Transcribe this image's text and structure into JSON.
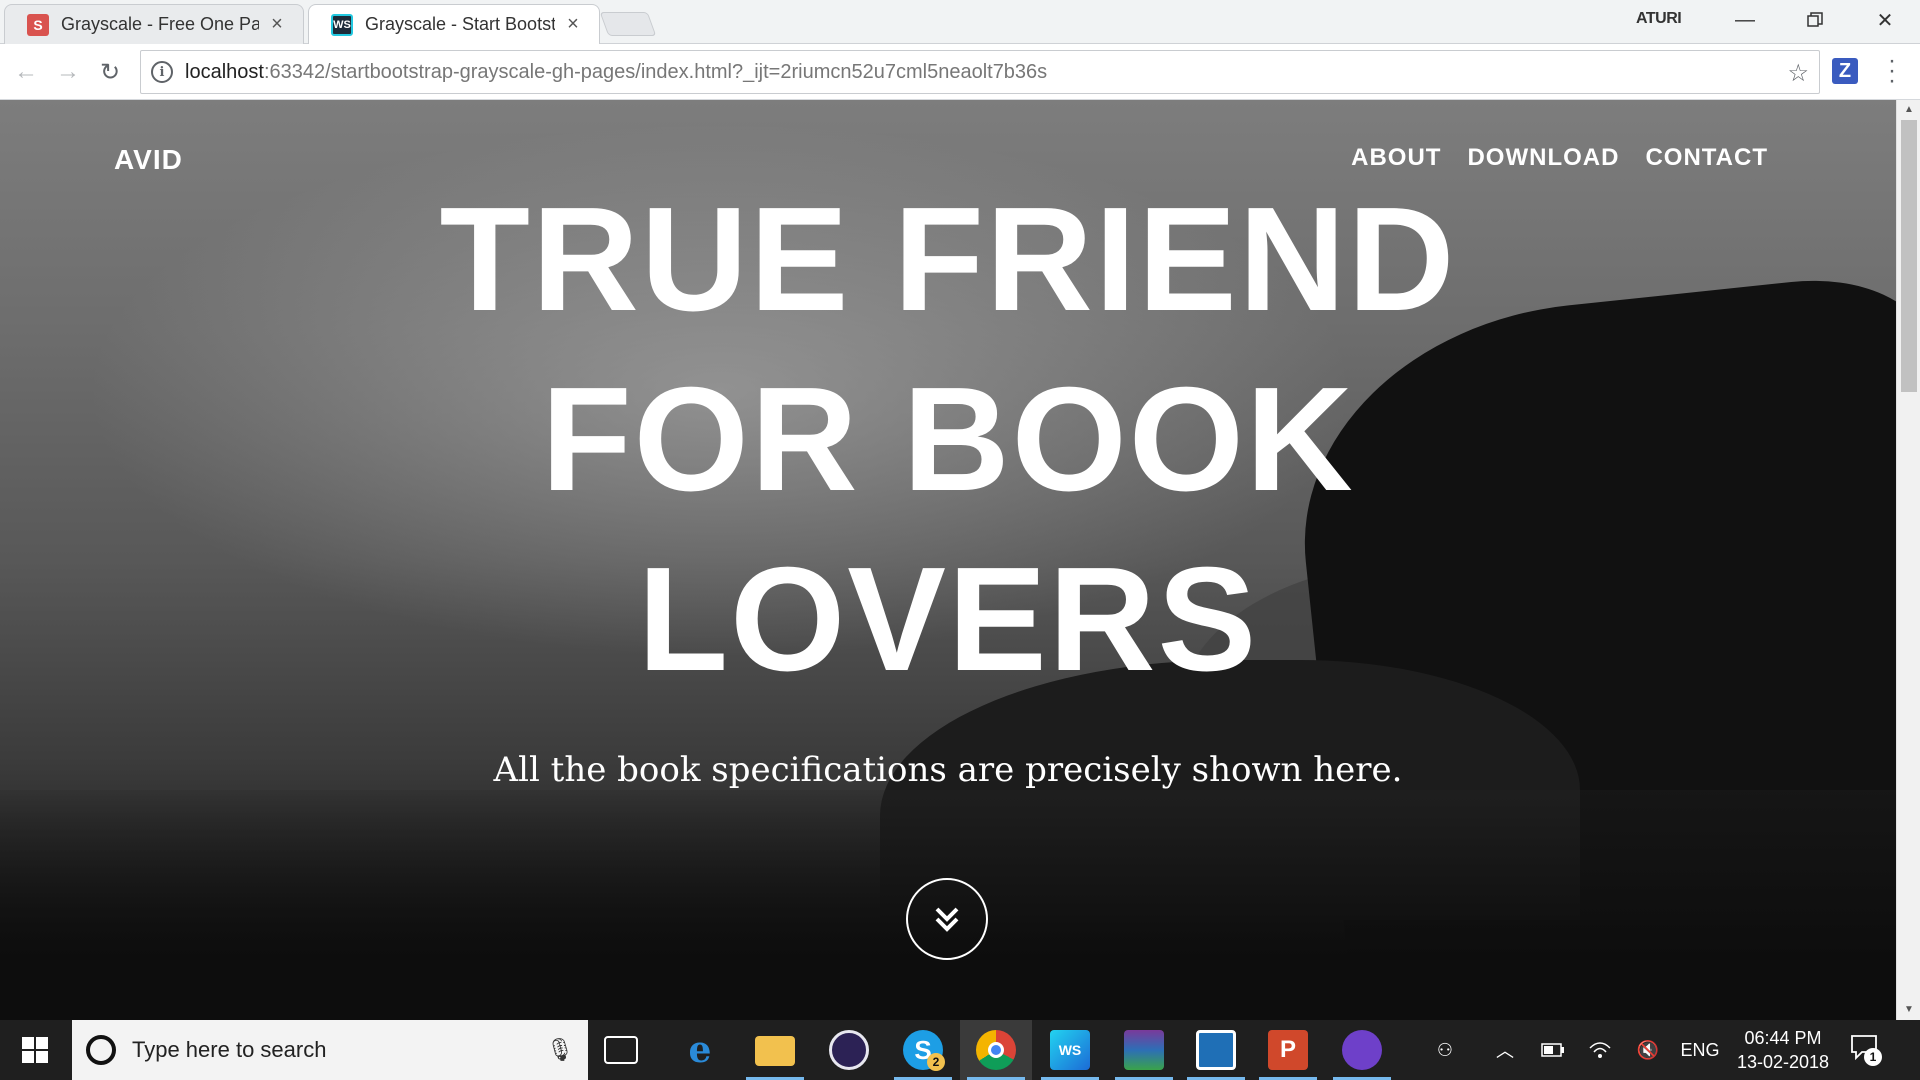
{
  "browser": {
    "tabs": [
      {
        "label": "Grayscale - Free One Pag",
        "favicon": "S",
        "favicon_color": "#d9534f",
        "active": false
      },
      {
        "label": "Grayscale - Start Bootstra",
        "favicon": "WS",
        "favicon_color": "#1c2b3a",
        "active": true
      }
    ],
    "profile_name": "ATURI",
    "url_host": "localhost",
    "url_rest": ":63342/startbootstrap-grayscale-gh-pages/index.html?_ijt=2riumcn52u7cml5neaolt7b36s",
    "extension_label": "Z"
  },
  "page": {
    "brand": "AVID",
    "nav": [
      "ABOUT",
      "DOWNLOAD",
      "CONTACT"
    ],
    "hero_lines": [
      "TRUE FRIEND",
      "FOR BOOK",
      "LOVERS"
    ],
    "tagline": "All the book specifications are precisely shown here."
  },
  "taskbar": {
    "search_placeholder": "Type here to search",
    "skype_badge": "2",
    "language": "ENG",
    "time": "06:44 PM",
    "date": "13-02-2018",
    "notification_count": "1"
  }
}
